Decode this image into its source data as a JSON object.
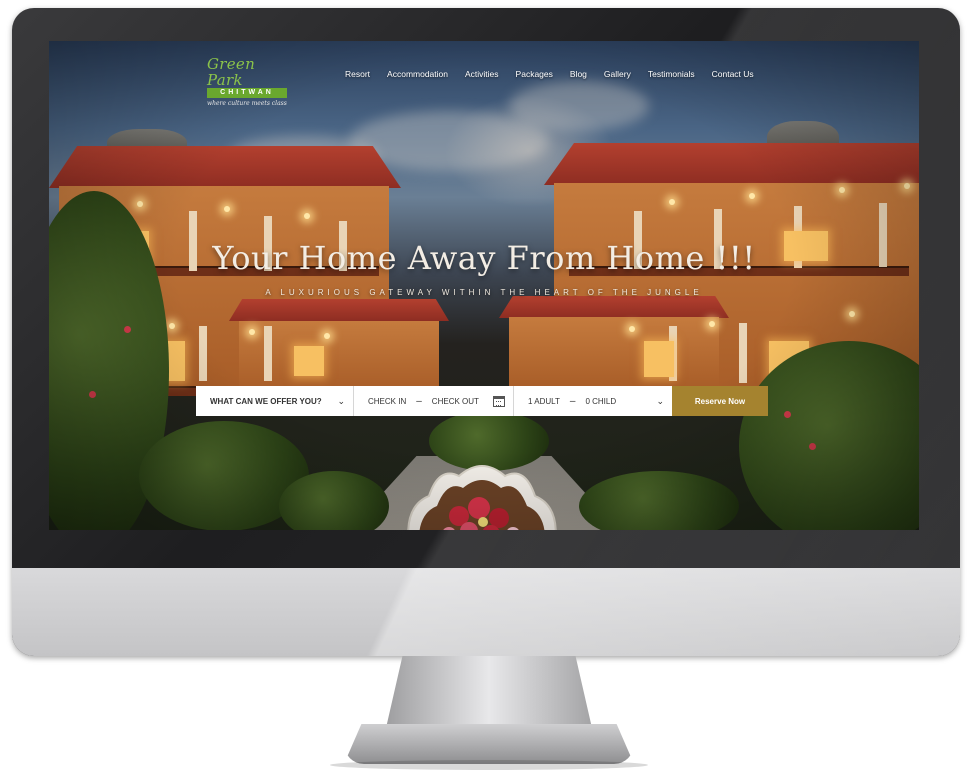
{
  "site": {
    "logo": {
      "name": "Green Park",
      "location": "CHITWAN",
      "tagline": "where culture meets class"
    },
    "nav": [
      "Resort",
      "Accommodation",
      "Activities",
      "Packages",
      "Blog",
      "Gallery",
      "Testimonials",
      "Contact Us"
    ]
  },
  "hero": {
    "title": "Your Home Away From Home !!!",
    "subtitle": "A LUXURIOUS GATEWAY WITHIN THE HEART OF THE JUNGLE"
  },
  "booking": {
    "offer_select": "WHAT CAN WE OFFER YOU?",
    "check_in": "CHECK IN",
    "check_out": "CHECK OUT",
    "adults": "1  ADULT",
    "children": "0  CHILD",
    "reserve_label": "Reserve Now",
    "separator": "–"
  },
  "colors": {
    "accent_gold": "#a5832f",
    "logo_green": "#6aa82e",
    "hero_text": "#f3ede4"
  },
  "icons": [
    "chevron-down-icon",
    "calendar-icon"
  ]
}
